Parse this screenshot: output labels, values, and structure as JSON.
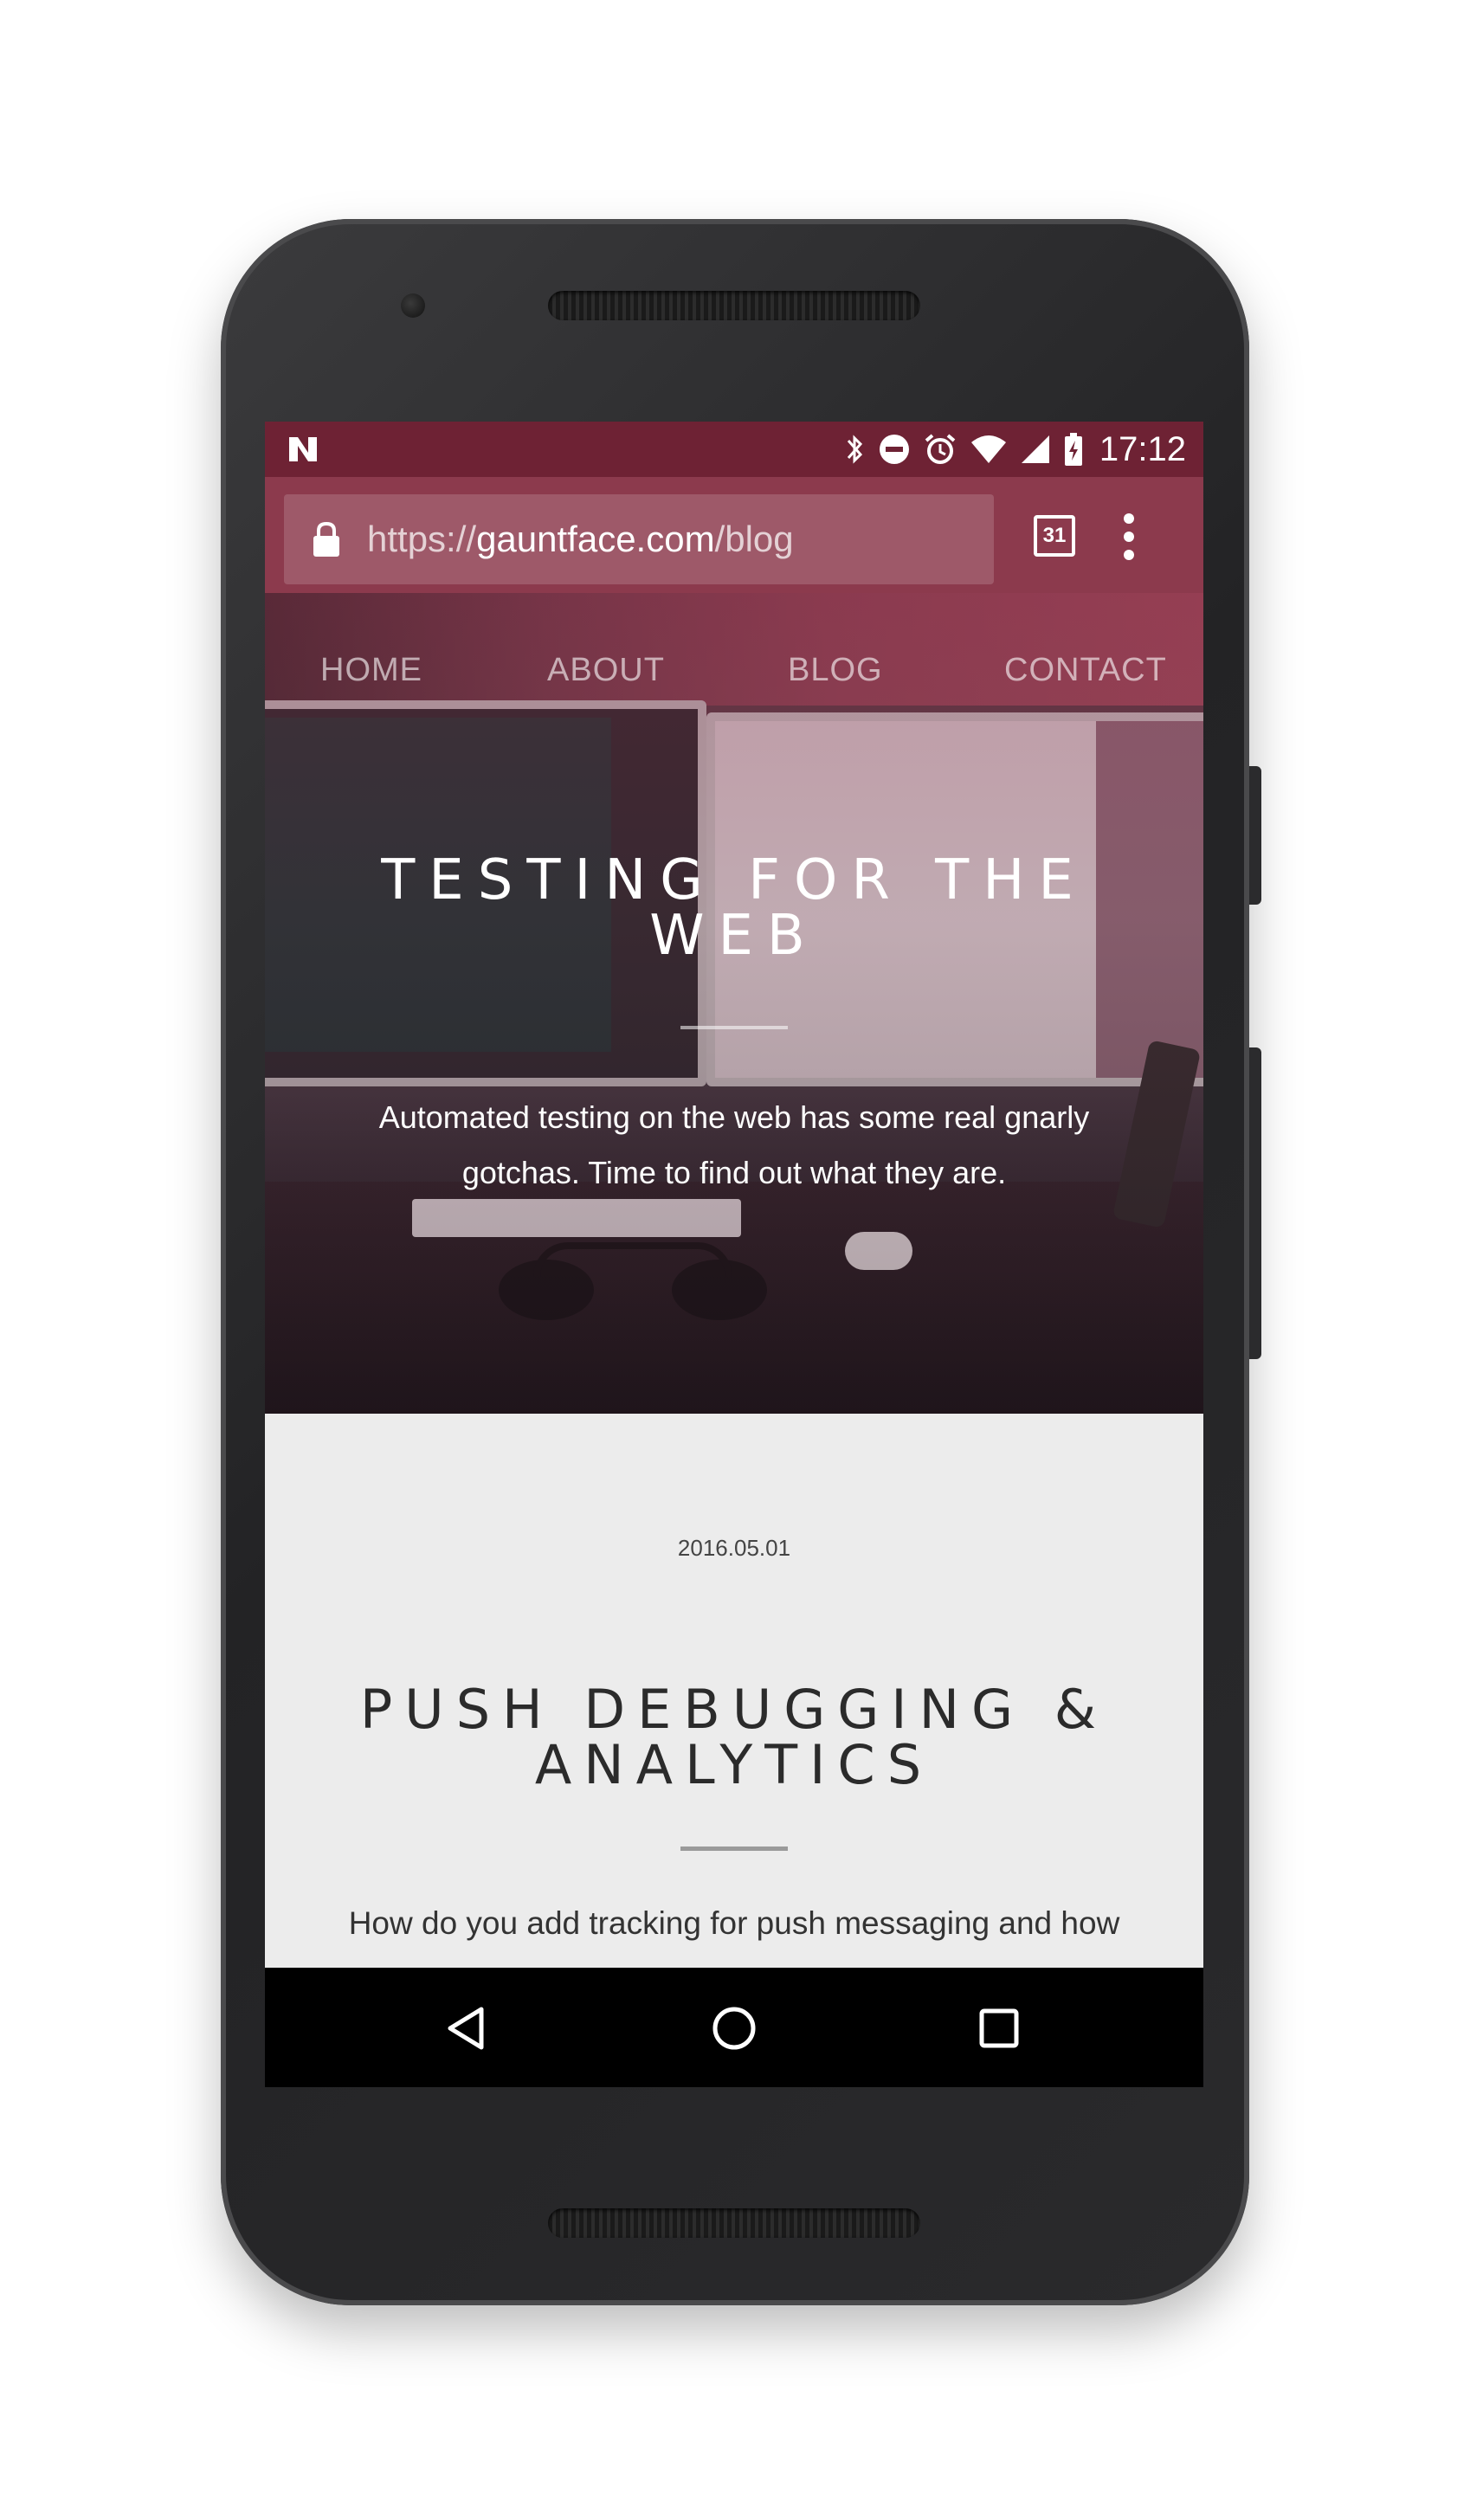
{
  "status_bar": {
    "time": "17:12",
    "icons": [
      "notification-n-icon",
      "bluetooth-icon",
      "do-not-disturb-icon",
      "alarm-icon",
      "wifi-icon",
      "cell-signal-icon",
      "battery-charging-icon"
    ]
  },
  "browser": {
    "url_prefix": "https://",
    "url_domain": "gauntface.com",
    "url_path": "/blog",
    "tab_count": "31"
  },
  "site_nav": {
    "items": [
      {
        "label": "HOME"
      },
      {
        "label": "ABOUT"
      },
      {
        "label": "BLOG"
      },
      {
        "label": "CONTACT"
      }
    ]
  },
  "hero": {
    "title": "TESTING FOR THE WEB",
    "description": "Automated testing on the web has some real gnarly gotchas. Time to find out what they are."
  },
  "post": {
    "date": "2016.05.01",
    "title": "PUSH DEBUGGING & ANALYTICS",
    "excerpt": "How do you add tracking for push messaging and how"
  },
  "colors": {
    "status_bar": "#6e2234",
    "toolbar": "#8c3a4d",
    "post_background": "#ececec",
    "nav_bar": "#000000"
  }
}
